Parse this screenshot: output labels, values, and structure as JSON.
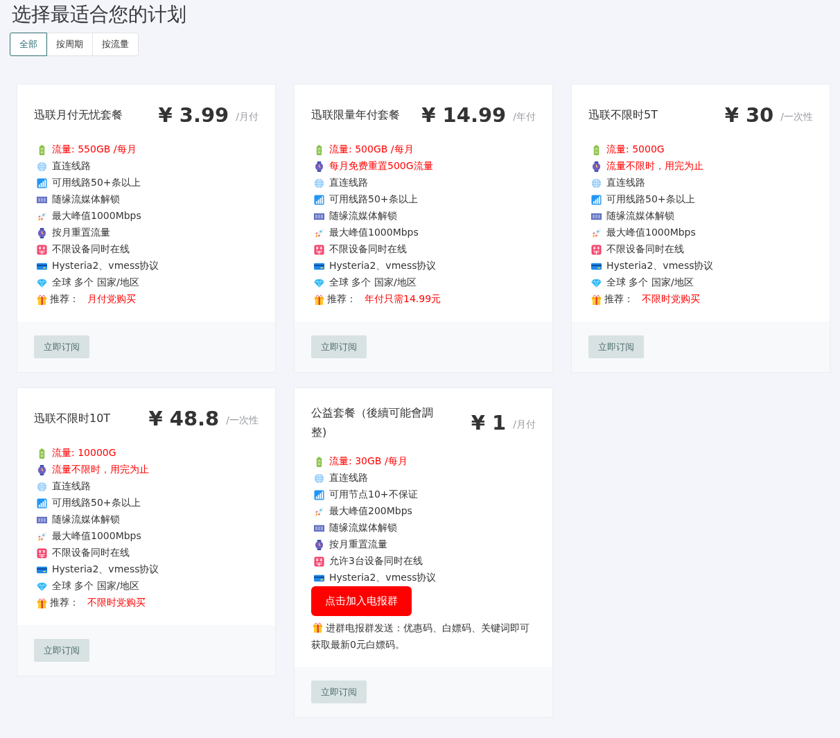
{
  "title": "选择最适合您的计划",
  "tabs": [
    {
      "label": "全部",
      "selected": true
    },
    {
      "label": "按周期",
      "selected": false
    },
    {
      "label": "按流量",
      "selected": false
    }
  ],
  "plans": [
    {
      "name": "迅联月付无忧套餐",
      "price": "¥ 3.99",
      "period": "/月付",
      "features": [
        {
          "kind": "battery",
          "text": "流量: 550GB /每月",
          "highlight": true
        },
        {
          "kind": "globe",
          "text": "直连线路",
          "highlight": false
        },
        {
          "kind": "signal",
          "text": "可用线路50+条以上",
          "highlight": false
        },
        {
          "kind": "film",
          "text": "随缘流媒体解锁",
          "highlight": false
        },
        {
          "kind": "rocket",
          "text": "最大峰值1000Mbps",
          "highlight": false
        },
        {
          "kind": "watch",
          "text": "按月重置流量",
          "highlight": false
        },
        {
          "kind": "ban",
          "text": "不限设备同时在线",
          "highlight": false
        },
        {
          "kind": "card",
          "text": "Hysteria2、vmess协议",
          "highlight": false
        },
        {
          "kind": "gem",
          "text": "全球 多个 国家/地区",
          "highlight": false
        }
      ],
      "recommend": {
        "label": "推荐：",
        "value": "月付党购买"
      },
      "button": "立即订阅"
    },
    {
      "name": "迅联限量年付套餐",
      "price": "¥ 14.99",
      "period": "/年付",
      "features": [
        {
          "kind": "battery",
          "text": "流量: 500GB /每月",
          "highlight": true
        },
        {
          "kind": "watch",
          "text": "每月免费重置500G流量",
          "highlight": true
        },
        {
          "kind": "globe",
          "text": "直连线路",
          "highlight": false
        },
        {
          "kind": "signal",
          "text": "可用线路50+条以上",
          "highlight": false
        },
        {
          "kind": "film",
          "text": "随缘流媒体解锁",
          "highlight": false
        },
        {
          "kind": "rocket",
          "text": "最大峰值1000Mbps",
          "highlight": false
        },
        {
          "kind": "ban",
          "text": "不限设备同时在线",
          "highlight": false
        },
        {
          "kind": "card",
          "text": "Hysteria2、vmess协议",
          "highlight": false
        },
        {
          "kind": "gem",
          "text": "全球 多个 国家/地区",
          "highlight": false
        }
      ],
      "recommend": {
        "label": "推荐：",
        "value": "年付只需14.99元"
      },
      "button": "立即订阅"
    },
    {
      "name": "迅联不限时5T",
      "price": "¥ 30",
      "period": "/一次性",
      "features": [
        {
          "kind": "battery",
          "text": "流量: 5000G",
          "highlight": true
        },
        {
          "kind": "watch",
          "text": "流量不限时，用完为止",
          "highlight": true
        },
        {
          "kind": "globe",
          "text": "直连线路",
          "highlight": false
        },
        {
          "kind": "signal",
          "text": "可用线路50+条以上",
          "highlight": false
        },
        {
          "kind": "film",
          "text": "随缘流媒体解锁",
          "highlight": false
        },
        {
          "kind": "rocket",
          "text": "最大峰值1000Mbps",
          "highlight": false
        },
        {
          "kind": "ban",
          "text": "不限设备同时在线",
          "highlight": false
        },
        {
          "kind": "card",
          "text": "Hysteria2、vmess协议",
          "highlight": false
        },
        {
          "kind": "gem",
          "text": "全球 多个 国家/地区",
          "highlight": false
        }
      ],
      "recommend": {
        "label": "推荐：",
        "value": "不限时党购买"
      },
      "button": "立即订阅"
    },
    {
      "name": "迅联不限时10T",
      "price": "¥ 48.8",
      "period": "/一次性",
      "features": [
        {
          "kind": "battery",
          "text": "流量: 10000G",
          "highlight": true
        },
        {
          "kind": "watch",
          "text": "流量不限时，用完为止",
          "highlight": true
        },
        {
          "kind": "globe",
          "text": "直连线路",
          "highlight": false
        },
        {
          "kind": "signal",
          "text": "可用线路50+条以上",
          "highlight": false
        },
        {
          "kind": "film",
          "text": "随缘流媒体解锁",
          "highlight": false
        },
        {
          "kind": "rocket",
          "text": "最大峰值1000Mbps",
          "highlight": false
        },
        {
          "kind": "ban",
          "text": "不限设备同时在线",
          "highlight": false
        },
        {
          "kind": "card",
          "text": "Hysteria2、vmess协议",
          "highlight": false
        },
        {
          "kind": "gem",
          "text": "全球 多个 国家/地区",
          "highlight": false
        }
      ],
      "recommend": {
        "label": "推荐：",
        "value": "不限时党购买"
      },
      "button": "立即订阅"
    },
    {
      "name": "公益套餐（後續可能會調整)",
      "price": "¥ 1",
      "period": "/月付",
      "features": [
        {
          "kind": "battery",
          "text": "流量: 30GB /每月",
          "highlight": true
        },
        {
          "kind": "globe",
          "text": "直连线路",
          "highlight": false
        },
        {
          "kind": "signal",
          "text": "可用节点10+不保证",
          "highlight": false
        },
        {
          "kind": "rocket",
          "text": "最大峰值200Mbps",
          "highlight": false
        },
        {
          "kind": "film",
          "text": "随缘流媒体解锁",
          "highlight": false
        },
        {
          "kind": "watch",
          "text": "按月重置流量",
          "highlight": false
        },
        {
          "kind": "ban",
          "text": "允许3台设备同时在线",
          "highlight": false
        },
        {
          "kind": "card",
          "text": "Hysteria2、vmess协议",
          "highlight": false
        }
      ],
      "join_button": "点击加入电报群",
      "note": "进群电报群发送：优惠码、白嫖码、关键词即可获取最新0元白嫖码。",
      "button": "立即订阅"
    }
  ]
}
